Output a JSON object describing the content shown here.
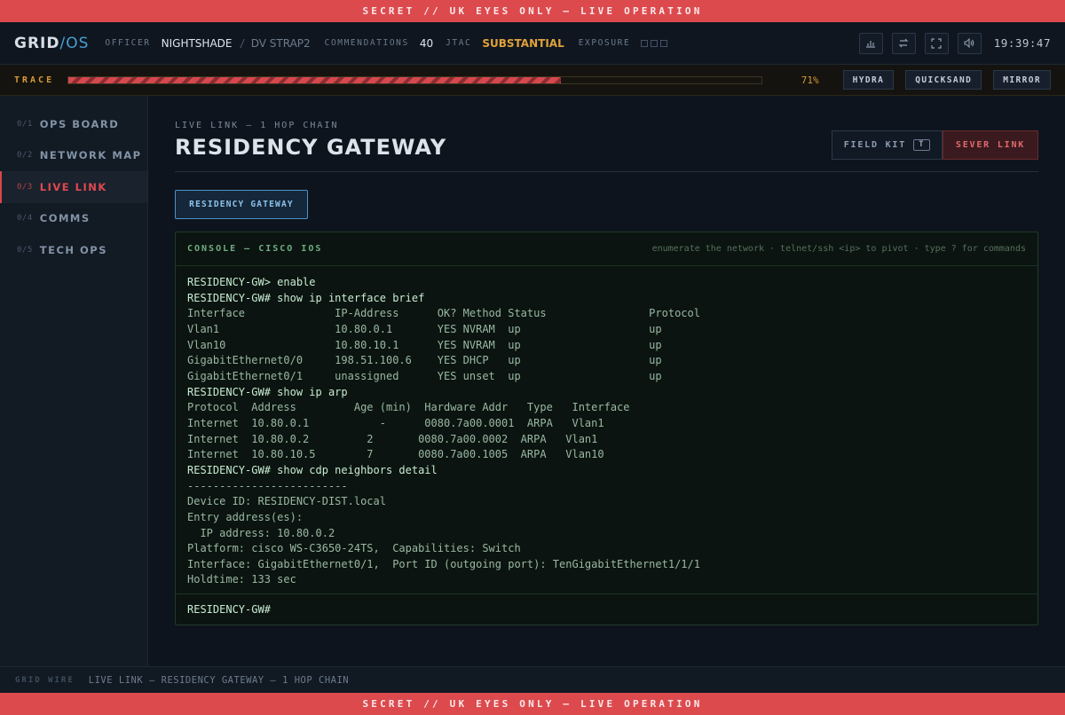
{
  "classification": "SECRET // UK EYES ONLY — LIVE OPERATION",
  "header": {
    "logo_main": "GRID",
    "logo_sep": "/",
    "logo_os": "OS",
    "officer_label": "OFFICER",
    "officer_name": "NIGHTSHADE",
    "officer_sep": "/",
    "officer_call": "DV STRAP2",
    "commendations_label": "COMMENDATIONS",
    "commendations_value": "40",
    "jtac_label": "JTAC",
    "jtac_value": "SUBSTANTIAL",
    "exposure_label": "EXPOSURE",
    "exposure_level": 0,
    "exposure_max": 3,
    "icons": [
      "bar-chart-icon",
      "swap-icon",
      "fullscreen-icon",
      "volume-icon"
    ],
    "clock": "19:39:47"
  },
  "trace": {
    "label": "TRACE",
    "percent": 71,
    "percent_text": "71%",
    "buttons": [
      "HYDRA",
      "QUICKSAND",
      "MIRROR"
    ]
  },
  "sidebar": {
    "items": [
      {
        "num": "0/1",
        "label": "OPS BOARD",
        "active": false
      },
      {
        "num": "0/2",
        "label": "NETWORK MAP",
        "active": false
      },
      {
        "num": "0/3",
        "label": "LIVE LINK",
        "active": true
      },
      {
        "num": "0/4",
        "label": "COMMS",
        "active": false
      },
      {
        "num": "0/5",
        "label": "TECH OPS",
        "active": false
      }
    ]
  },
  "main": {
    "subtitle": "LIVE LINK — 1 HOP CHAIN",
    "title": "RESIDENCY GATEWAY",
    "field_kit_label": "FIELD KIT",
    "field_kit_key": "T",
    "sever_label": "SEVER LINK",
    "chip_label": "RESIDENCY GATEWAY"
  },
  "console": {
    "title": "CONSOLE — CISCO IOS",
    "hint": "enumerate the network · telnet/ssh <ip> to pivot · type ? for commands",
    "lines": [
      {
        "t": "RESIDENCY-GW> enable",
        "cmd": true
      },
      {
        "t": "RESIDENCY-GW# show ip interface brief",
        "cmd": true
      },
      {
        "t": "Interface              IP-Address      OK? Method Status                Protocol",
        "cmd": false
      },
      {
        "t": "Vlan1                  10.80.0.1       YES NVRAM  up                    up",
        "cmd": false
      },
      {
        "t": "Vlan10                 10.80.10.1      YES NVRAM  up                    up",
        "cmd": false
      },
      {
        "t": "GigabitEthernet0/0     198.51.100.6    YES DHCP   up                    up",
        "cmd": false
      },
      {
        "t": "GigabitEthernet0/1     unassigned      YES unset  up                    up",
        "cmd": false
      },
      {
        "t": "RESIDENCY-GW# show ip arp",
        "cmd": true
      },
      {
        "t": "Protocol  Address         Age (min)  Hardware Addr   Type   Interface",
        "cmd": false
      },
      {
        "t": "Internet  10.80.0.1           -      0080.7a00.0001  ARPA   Vlan1",
        "cmd": false
      },
      {
        "t": "Internet  10.80.0.2         2       0080.7a00.0002  ARPA   Vlan1",
        "cmd": false
      },
      {
        "t": "Internet  10.80.10.5        7       0080.7a00.1005  ARPA   Vlan10",
        "cmd": false
      },
      {
        "t": "RESIDENCY-GW# show cdp neighbors detail",
        "cmd": true
      },
      {
        "t": "-------------------------",
        "cmd": false
      },
      {
        "t": "Device ID: RESIDENCY-DIST.local",
        "cmd": false
      },
      {
        "t": "Entry address(es):",
        "cmd": false
      },
      {
        "t": "  IP address: 10.80.0.2",
        "cmd": false
      },
      {
        "t": "Platform: cisco WS-C3650-24TS,  Capabilities: Switch",
        "cmd": false
      },
      {
        "t": "Interface: GigabitEthernet0/1,  Port ID (outgoing port): TenGigabitEthernet1/1/1",
        "cmd": false
      },
      {
        "t": "Holdtime: 133 sec",
        "cmd": false
      }
    ],
    "prompt": "RESIDENCY-GW#",
    "input_value": ""
  },
  "footer": {
    "label": "GRID WIRE",
    "text": "LIVE LINK — RESIDENCY GATEWAY — 1 HOP CHAIN"
  },
  "colors": {
    "classification_bg": "#dc4a4e",
    "accent_blue": "#4aa0d0",
    "warn_amber": "#e0a23a",
    "danger_red": "#e0494e",
    "console_green": "#9ab8a4"
  }
}
